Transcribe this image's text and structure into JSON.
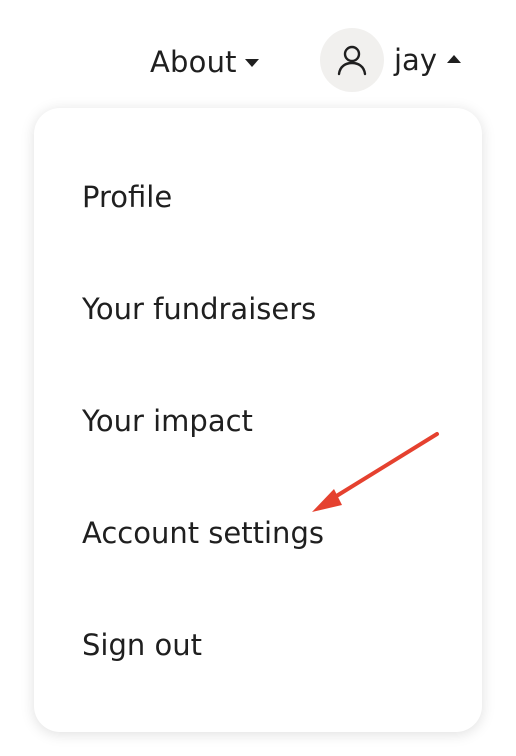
{
  "nav": {
    "about_label": "About",
    "user_name": "jay"
  },
  "menu": {
    "items": [
      {
        "label": "Profile"
      },
      {
        "label": "Your fundraisers"
      },
      {
        "label": "Your impact"
      },
      {
        "label": "Account settings"
      },
      {
        "label": "Sign out"
      }
    ]
  },
  "annotation": {
    "arrow_color": "#e5412f"
  }
}
